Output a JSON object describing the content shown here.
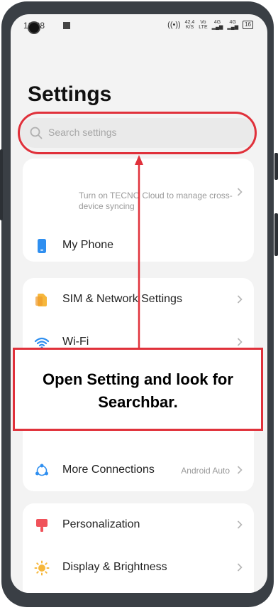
{
  "status_bar": {
    "time": "12:38",
    "net_speed_value": "42.4",
    "net_speed_unit": "K/S",
    "volte_1": "Vo",
    "volte_2": "LTE",
    "sim1_signal": "4G",
    "sim2_signal": "4G",
    "battery": "16"
  },
  "page": {
    "title": "Settings"
  },
  "search": {
    "placeholder": "Search settings"
  },
  "cloud_card": {
    "promo_text": "Turn on TECNO Cloud to manage cross-device syncing",
    "my_phone_label": "My Phone"
  },
  "network_card": {
    "items": [
      {
        "label": "SIM & Network Settings",
        "value": "",
        "icon": "sim-card-icon"
      },
      {
        "label": "Wi-Fi",
        "value": "",
        "icon": "wifi-icon"
      },
      {
        "label": "More Connections",
        "value": "Android Auto",
        "icon": "connections-icon"
      }
    ]
  },
  "display_card": {
    "items": [
      {
        "label": "Personalization",
        "value": "",
        "icon": "personalization-icon"
      },
      {
        "label": "Display & Brightness",
        "value": "",
        "icon": "brightness-icon"
      }
    ]
  },
  "annotation": {
    "callout_text": "Open Setting and look for Searchbar.",
    "accent_color": "#e0313b"
  }
}
